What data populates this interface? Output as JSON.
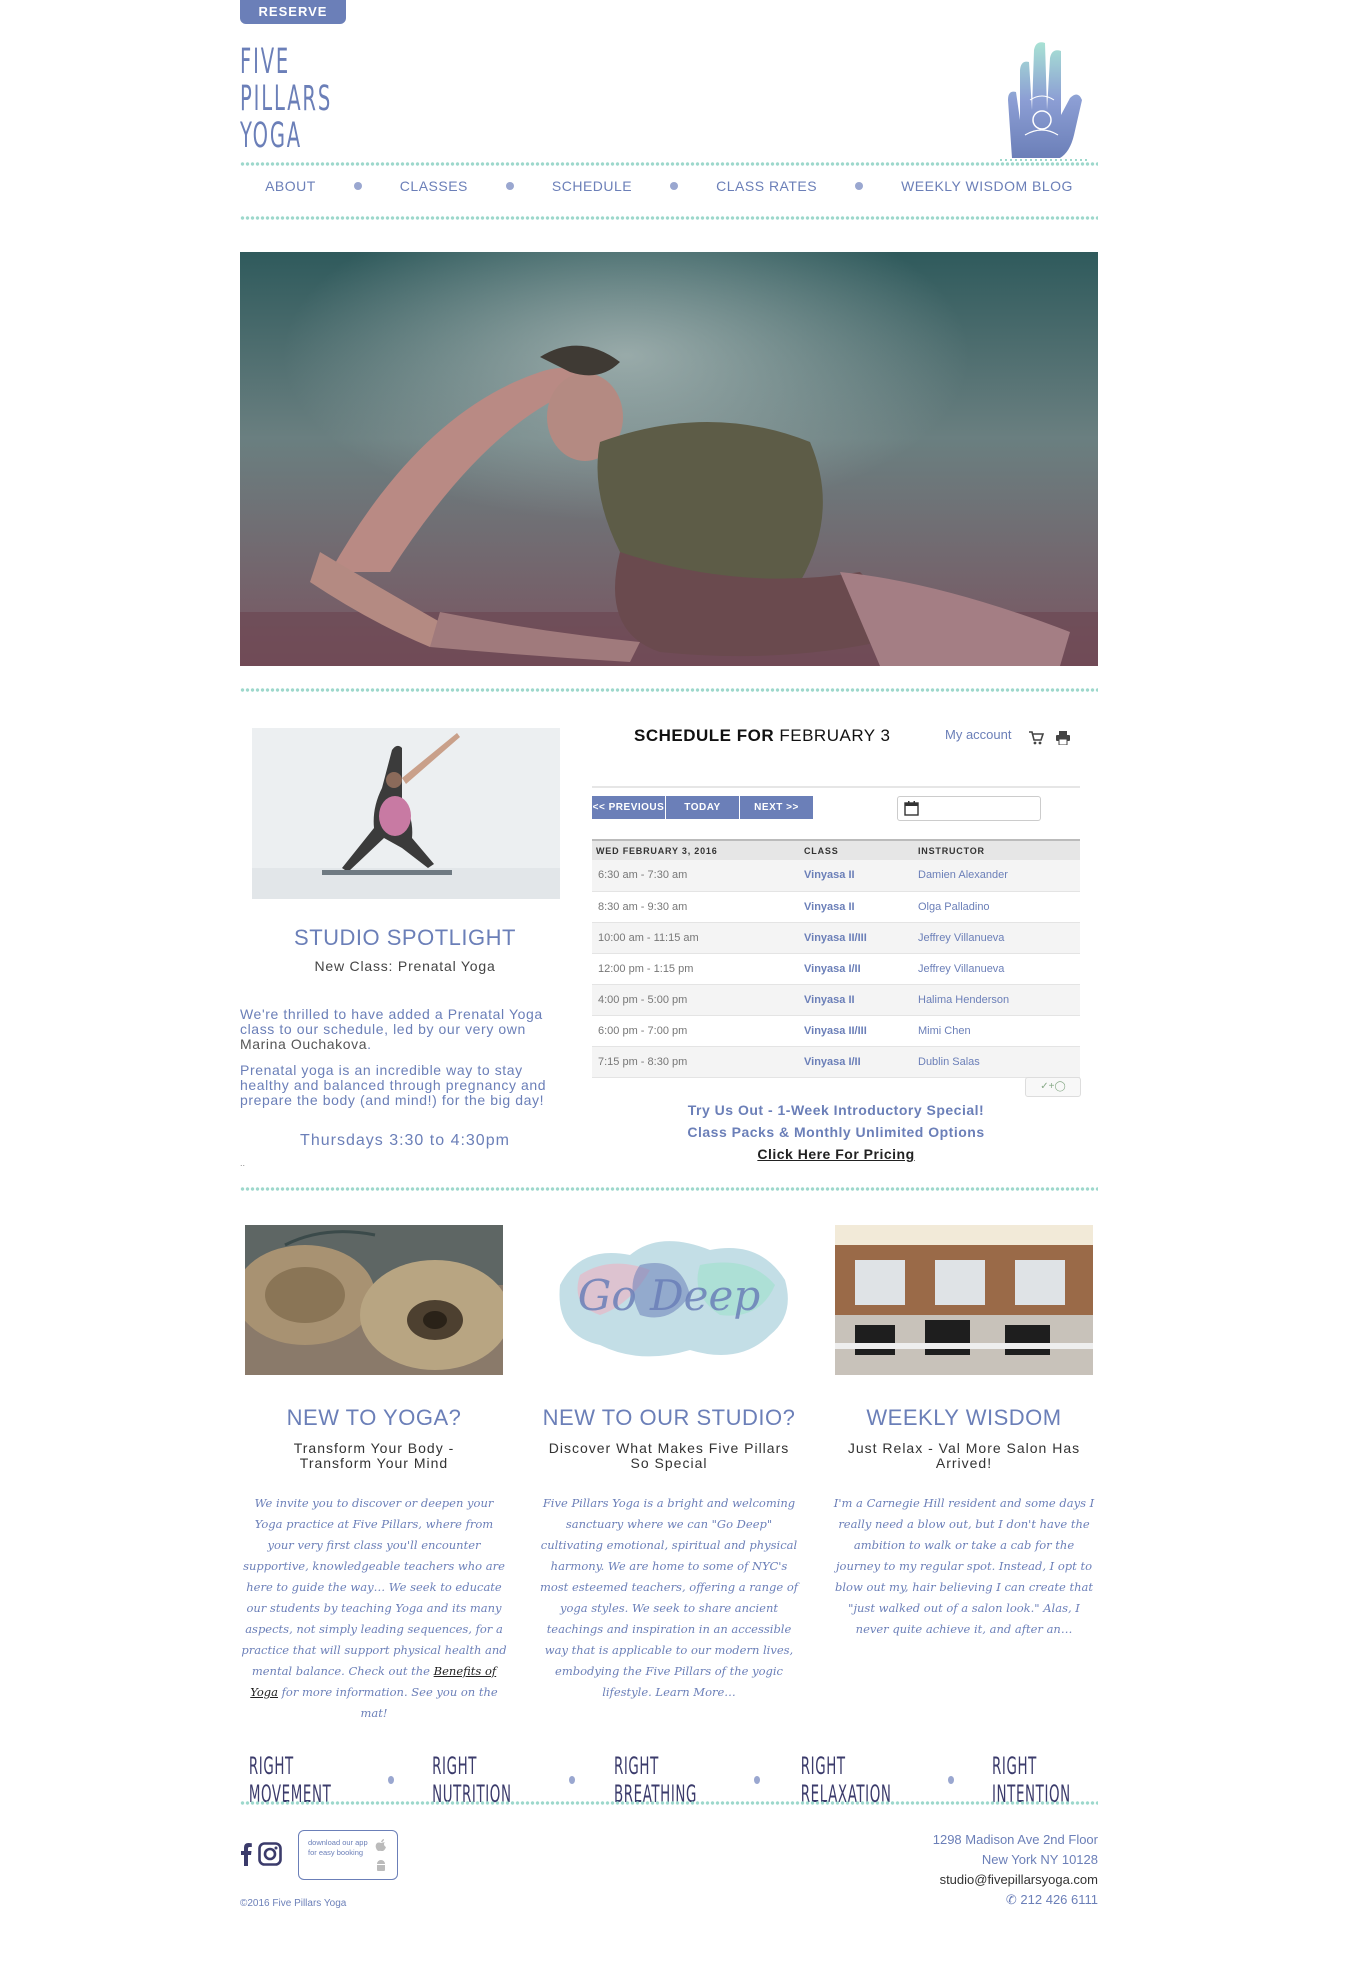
{
  "header": {
    "reserve_label": "RESERVE",
    "logo_lines": [
      "FIVE",
      "PILLARS",
      "YOGA"
    ]
  },
  "nav": {
    "items": [
      "ABOUT",
      "CLASSES",
      "SCHEDULE",
      "CLASS RATES",
      "WEEKLY WISDOM BLOG"
    ]
  },
  "spotlight": {
    "title": "STUDIO SPOTLIGHT",
    "subtitle": "New Class: Prenatal Yoga",
    "para1_a": "We're thrilled to have added a Prenatal Yoga class to our schedule, led by our very own ",
    "para1_b": "Marina Ouchakova",
    "para1_c": ".",
    "para2": "Prenatal yoga is an incredible way to stay healthy and balanced through pregnancy and prepare the body (and mind!) for the big day!",
    "time": "Thursdays 3:30 to 4:30pm",
    "dots": ".."
  },
  "schedule": {
    "title_bold": "SCHEDULE FOR",
    "title_date": "FEBRUARY 3",
    "my_account": "My account",
    "prev_label": "<< PREVIOUS",
    "today_label": "TODAY",
    "next_label": "NEXT >>",
    "date_value": "",
    "columns": [
      "WED FEBRUARY 3, 2016",
      "CLASS",
      "INSTRUCTOR"
    ],
    "rows": [
      {
        "time": "6:30 am - 7:30 am",
        "class": "Vinyasa II",
        "instructor": "Damien Alexander"
      },
      {
        "time": "8:30 am - 9:30 am",
        "class": "Vinyasa II",
        "instructor": "Olga Palladino"
      },
      {
        "time": "10:00 am - 11:15 am",
        "class": "Vinyasa II/III",
        "instructor": "Jeffrey Villanueva"
      },
      {
        "time": "12:00 pm - 1:15 pm",
        "class": "Vinyasa I/II",
        "instructor": "Jeffrey Villanueva"
      },
      {
        "time": "4:00 pm - 5:00 pm",
        "class": "Vinyasa II",
        "instructor": "Halima Henderson"
      },
      {
        "time": "6:00 pm - 7:00 pm",
        "class": "Vinyasa II/III",
        "instructor": "Mimi Chen"
      },
      {
        "time": "7:15 pm - 8:30 pm",
        "class": "Vinyasa I/II",
        "instructor": "Dublin Salas"
      }
    ],
    "badge": "✓+◯",
    "promo1": "Try Us Out - 1-Week Introductory Special!",
    "promo2": "Class Packs & Monthly Unlimited Options",
    "promo_link": "Click Here For Pricing"
  },
  "columns": [
    {
      "title": "NEW TO YOGA?",
      "sub1": "Transform Your Body -",
      "sub2": "Transform Your Mind",
      "body_a": "We invite you to discover or deepen your Yoga practice at Five Pillars, where from your very first class you'll encounter supportive, knowledgeable teachers who are here to guide the way… We seek to educate our students by teaching Yoga and its many aspects, not simply leading sequences, for a practice that will support physical health and mental balance. Check out the ",
      "body_link": "Benefits of Yoga",
      "body_b": " for more information. See you on the mat!"
    },
    {
      "title": "NEW TO OUR STUDIO?",
      "sub1": "Discover What Makes Five Pillars",
      "sub2": "So Special",
      "body_a": "Five Pillars Yoga is a bright and welcoming sanctuary where we can \"Go Deep\" cultivating emotional, spiritual and physical harmony. We are home to some of NYC's most esteemed teachers, offering a range of yoga styles. We seek to share ancient teachings and inspiration in an accessible way that is applicable to our modern lives, embodying the Five Pillars of the yogic lifestyle. Learn More…",
      "image_text": "Go Deep"
    },
    {
      "title": "WEEKLY WISDOM",
      "sub1": "Just Relax - Val More Salon Has",
      "sub2": "Arrived!",
      "body_a": "I'm a Carnegie Hill resident and some days I really need a blow out, but I don't have the ambition to walk or take a cab for the journey to my regular spot. Instead, I opt to blow out my, hair believing I can create that \"just walked out of a salon look.\" Alas, I never quite achieve it, and after an…"
    }
  ],
  "pillars": [
    "RIGHT MOVEMENT",
    "RIGHT NUTRITION",
    "RIGHT BREATHING",
    "RIGHT RELAXATION",
    "RIGHT INTENTION"
  ],
  "footer": {
    "app_text": "download our app for easy booking",
    "copyright": "©2016 Five Pillars Yoga",
    "address1": "1298 Madison Ave 2nd Floor",
    "address2": "New York NY 10128",
    "email": "studio@fivepillarsyoga.com",
    "phone": "212 426 6111"
  },
  "colors": {
    "accent": "#6b7fb8",
    "mint": "#9ed8cc"
  }
}
